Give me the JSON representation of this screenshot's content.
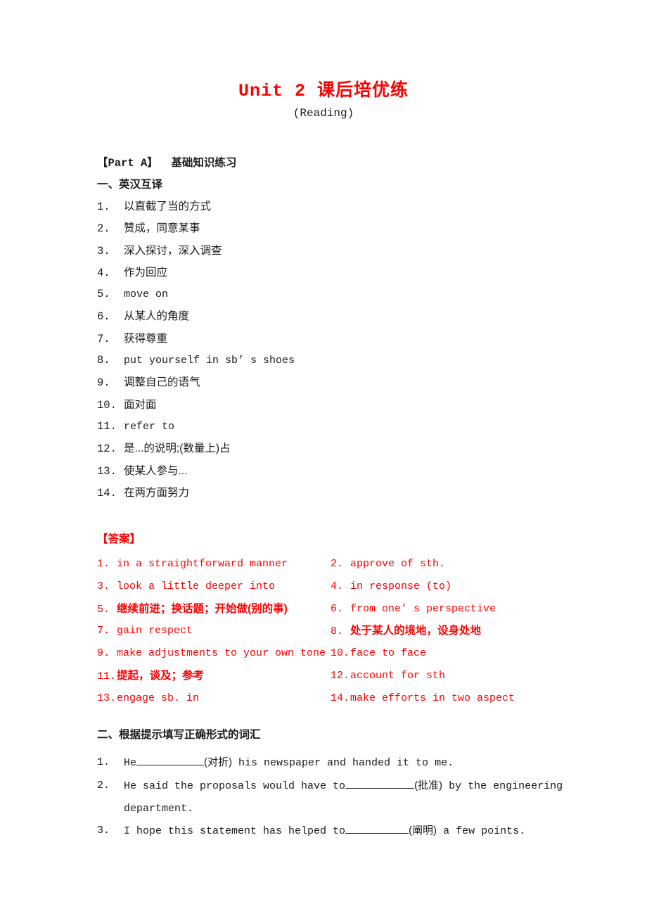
{
  "document": {
    "title": "Unit 2 课后培优练",
    "subtitle": "(Reading)",
    "title_color": "#ff0000",
    "body_color": "#1a1a1a",
    "background": "#ffffff"
  },
  "part_a": {
    "heading": "【Part A】  基础知识练习"
  },
  "section_one": {
    "heading": "一、英汉互译",
    "items": [
      {
        "num": "1.",
        "text": "以直截了当的方式",
        "lang": "cn"
      },
      {
        "num": "2.",
        "text": "赞成，同意某事",
        "lang": "cn"
      },
      {
        "num": "3.",
        "text": "深入探讨，深入调查",
        "lang": "cn"
      },
      {
        "num": "4.",
        "text": "作为回应",
        "lang": "cn"
      },
      {
        "num": "5.",
        "text": "move on",
        "lang": "en"
      },
      {
        "num": "6.",
        "text": "从某人的角度",
        "lang": "cn"
      },
      {
        "num": "7.",
        "text": "获得尊重",
        "lang": "cn"
      },
      {
        "num": "8.",
        "text": "put yourself in sb’ s shoes",
        "lang": "en"
      },
      {
        "num": "9.",
        "text": "调整自己的语气",
        "lang": "cn"
      },
      {
        "num": "10.",
        "text": "面对面",
        "lang": "cn"
      },
      {
        "num": "11.",
        "text": "refer to",
        "lang": "en"
      },
      {
        "num": "12.",
        "text": "是...的说明;(数量上)占",
        "lang": "cn"
      },
      {
        "num": "13.",
        "text": "使某人参与...",
        "lang": "cn"
      },
      {
        "num": "14.",
        "text": "在两方面努力",
        "lang": "cn"
      }
    ]
  },
  "answers": {
    "heading": "【答案】",
    "color": "#ff0000",
    "rows": [
      {
        "left": {
          "num": "1.",
          "text": "in a straightforward manner",
          "lang": "en"
        },
        "right": {
          "num": "2.",
          "text": "approve of sth.",
          "lang": "en"
        }
      },
      {
        "left": {
          "num": "3.",
          "text": "look a little deeper into",
          "lang": "en"
        },
        "right": {
          "num": "4.",
          "text": "in response (to)",
          "lang": "en"
        }
      },
      {
        "left": {
          "num": "5.",
          "text": "继续前进；换话题；开始做(别的事)",
          "lang": "cn"
        },
        "right": {
          "num": "6.",
          "text": "from one’ s perspective",
          "lang": "en"
        }
      },
      {
        "left": {
          "num": "7.",
          "text": "gain respect",
          "lang": "en"
        },
        "right": {
          "num": "8.",
          "text": "处于某人的境地，设身处地",
          "lang": "cn"
        }
      },
      {
        "left": {
          "num": "9.",
          "text": "make adjustments to your own tone",
          "lang": "en"
        },
        "right": {
          "num": "10.",
          "text": "face to face",
          "lang": "en"
        }
      },
      {
        "left": {
          "num": "11.",
          "text": "提起，谈及；参考",
          "lang": "cn"
        },
        "right": {
          "num": "12.",
          "text": "account for sth",
          "lang": "en"
        }
      },
      {
        "left": {
          "num": "13.",
          "text": "engage sb. in",
          "lang": "en"
        },
        "right": {
          "num": "14.",
          "text": "make efforts in two aspect",
          "lang": "en"
        }
      }
    ]
  },
  "section_two": {
    "heading": "二、根据提示填写正确形式的词汇",
    "questions": [
      {
        "num": "1.",
        "before": "He",
        "hint": "(对折)",
        "after": " his newspaper and handed it to me.",
        "continuation": ""
      },
      {
        "num": "2.",
        "before": "He said the proposals would have to",
        "hint": "(批准)",
        "after": " by the engineering",
        "continuation": "department."
      },
      {
        "num": "3.",
        "before": "I hope this statement has helped to",
        "hint": "(阐明)",
        "after": " a few points.",
        "continuation": ""
      }
    ]
  }
}
